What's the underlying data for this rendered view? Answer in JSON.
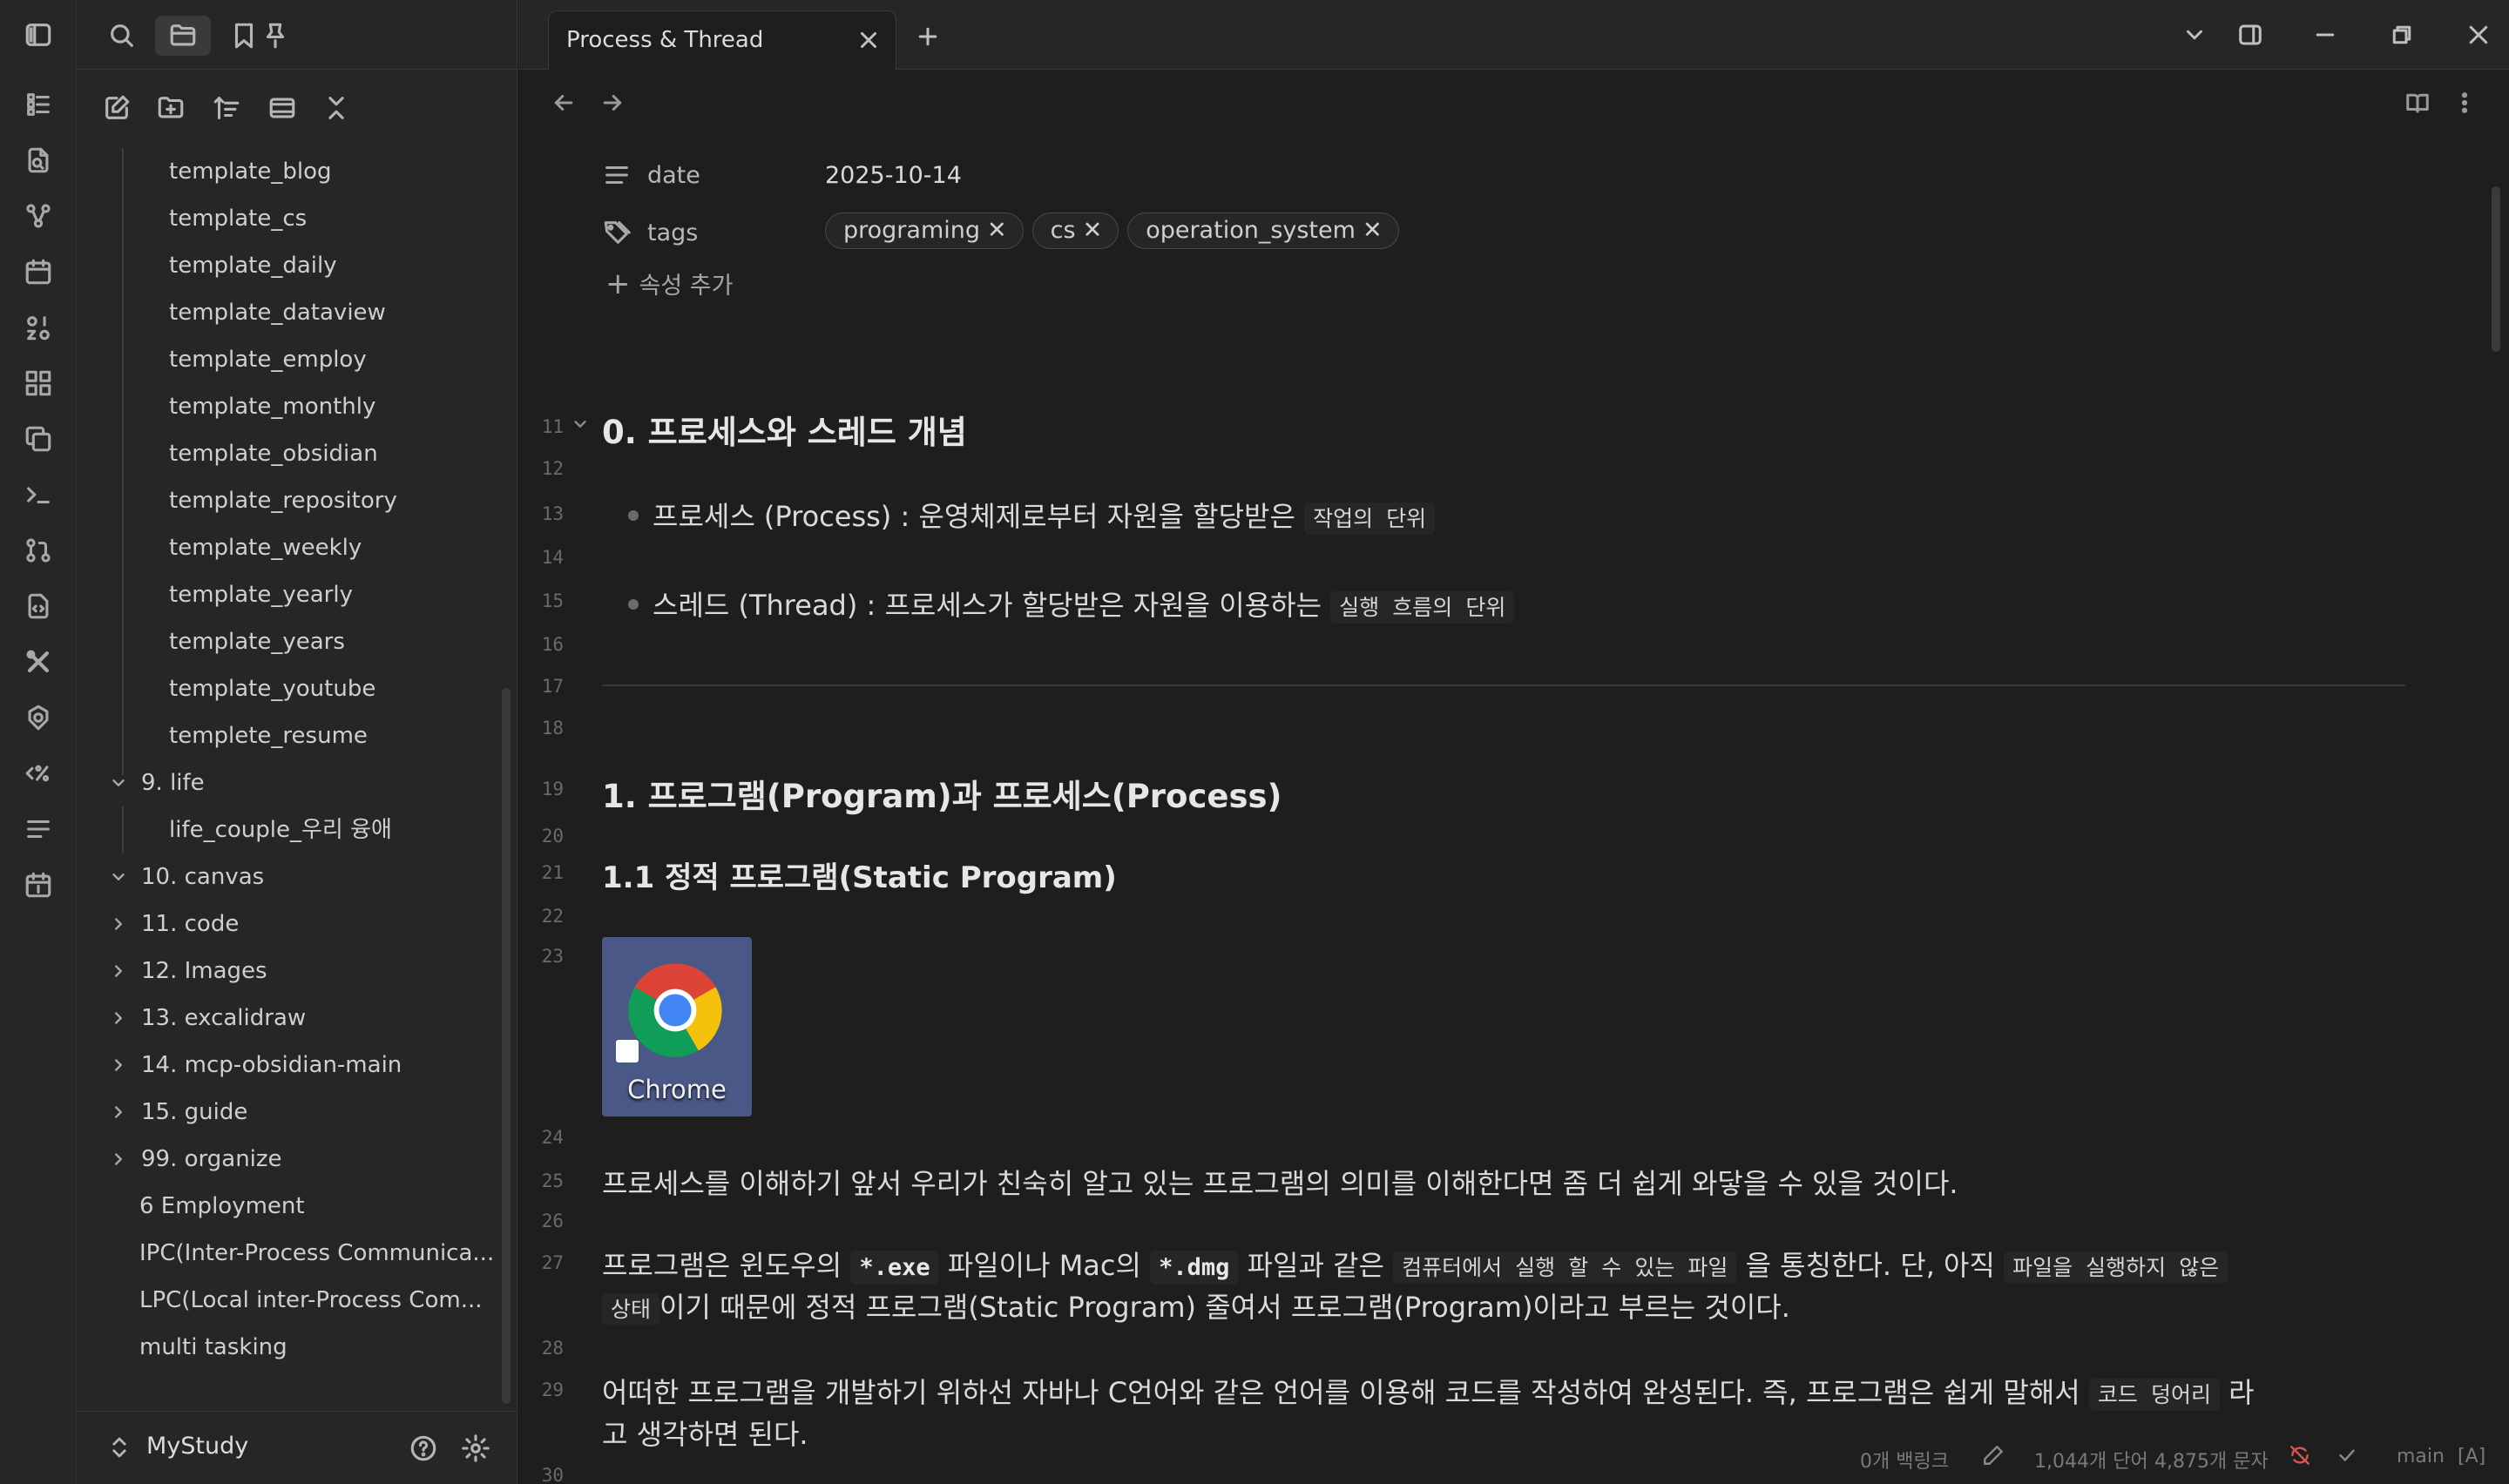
{
  "tab": {
    "title": "Process & Thread"
  },
  "vault": {
    "name": "MyStudy"
  },
  "tree": {
    "templates": [
      "template_blog",
      "template_cs",
      "template_daily",
      "template_dataview",
      "template_employ",
      "template_monthly",
      "template_obsidian",
      "template_repository",
      "template_weekly",
      "template_yearly",
      "template_years",
      "template_youtube",
      "templete_resume"
    ],
    "folder_life": "9. life",
    "life_child": "life_couple_우리 융애",
    "folder_canvas": "10. canvas",
    "folders": [
      "11. code",
      "12. Images",
      "13. excalidraw",
      "14. mcp-obsidian-main",
      "15. guide",
      "99. organize"
    ],
    "files": [
      "6 Employment",
      "IPC(Inter-Process Communica...",
      "LPC(Local inter-Process Com...",
      "multi tasking"
    ]
  },
  "properties": {
    "date_label": "date",
    "date_value": "2025-10-14",
    "tags_label": "tags",
    "tags": [
      "programing",
      "cs",
      "operation_system"
    ],
    "add_label": "속성 추가"
  },
  "doc": {
    "ln": [
      "11",
      "12",
      "13",
      "14",
      "15",
      "16",
      "17",
      "18",
      "19",
      "20",
      "21",
      "22",
      "23",
      "24",
      "25",
      "26",
      "27",
      "28",
      "29",
      "30"
    ],
    "h_0": "0. 프로세스와 스레드 개념",
    "b1_text": "프로세스 (Process) : 운영체제로부터 자원을 할당받은",
    "b1_code": "작업의 단위",
    "b2_text": "스레드 (Thread) : 프로세스가 할당받은 자원을 이용하는",
    "b2_code": "실행 흐름의 단위",
    "h_1": "1. 프로그램(Program)과 프로세스(Process)",
    "h_11": "1.1 정적 프로그램(Static Program)",
    "img_label": "Chrome",
    "p25": "프로세스를 이해하기 앞서 우리가 친숙히 알고 있는 프로그램의 의미를 이해한다면 좀 더 쉽게 와닿을 수 있을 것이다.",
    "p27_a": "프로그램은 윈도우의",
    "p27_exe": "*.exe",
    "p27_b": "파일이나 Mac의",
    "p27_dmg": "*.dmg",
    "p27_c": "파일과 같은",
    "p27_code1": "컴퓨터에서 실행 할 수 있는 파일",
    "p27_d": "을 통칭한다. 단, 아직",
    "p27_code2": "파일을 실행하지 않은",
    "p27_code3": "상태",
    "p27_e": "이기 때문에 정적 프로그램(Static Program) 줄여서 프로그램(Program)이라고 부르는 것이다.",
    "p29_a": "어떠한 프로그램을 개발하기 위하선 자바나 C언어와 같은 언어를 이용해 코드를 작성하여 완성된다. 즉, 프로그램은 쉽게 말해서",
    "p29_code": "코드 덩어리",
    "p29_b": "라",
    "p29_c": "고 생각하면 된다."
  },
  "status": {
    "backlinks": "0개 백링크",
    "words": "1,044개 단어",
    "chars": "4,875개 문자",
    "branch": "main",
    "mode": "[A]"
  }
}
